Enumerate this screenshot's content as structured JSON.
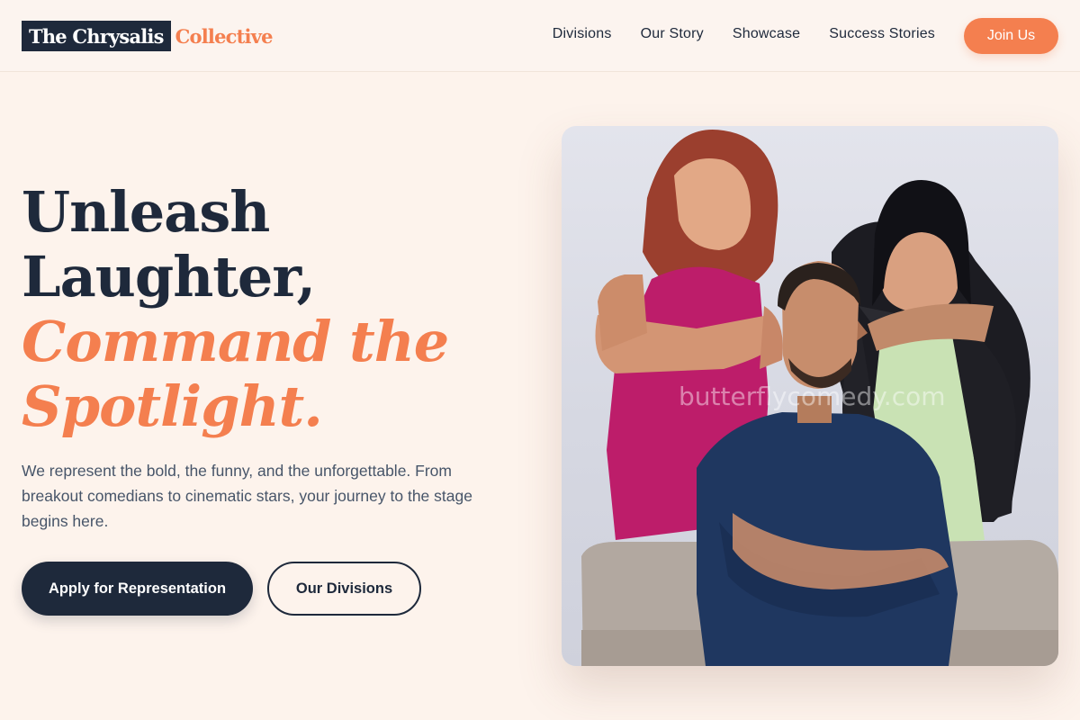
{
  "brand": {
    "name_dark": "The Chrysalis",
    "name_accent": "Collective",
    "colors": {
      "primary": "#1e293b",
      "accent": "#f47f4f",
      "background": "#fdf3ec"
    }
  },
  "nav": {
    "items": [
      {
        "label": "Divisions"
      },
      {
        "label": "Our Story"
      },
      {
        "label": "Showcase"
      },
      {
        "label": "Success Stories"
      }
    ],
    "cta_label": "Join Us"
  },
  "hero": {
    "headline_line1": "Unleash",
    "headline_line2": "Laughter,",
    "headline_accent1": "Command the",
    "headline_accent2": "Spotlight.",
    "lede": "We represent the bold, the funny, and the unforgettable. From breakout comedians to cinematic stars, your journey to the stage begins here.",
    "primary_cta": "Apply for Representation",
    "secondary_cta": "Our Divisions"
  },
  "photo": {
    "watermark": "butterflycomedy.com"
  }
}
